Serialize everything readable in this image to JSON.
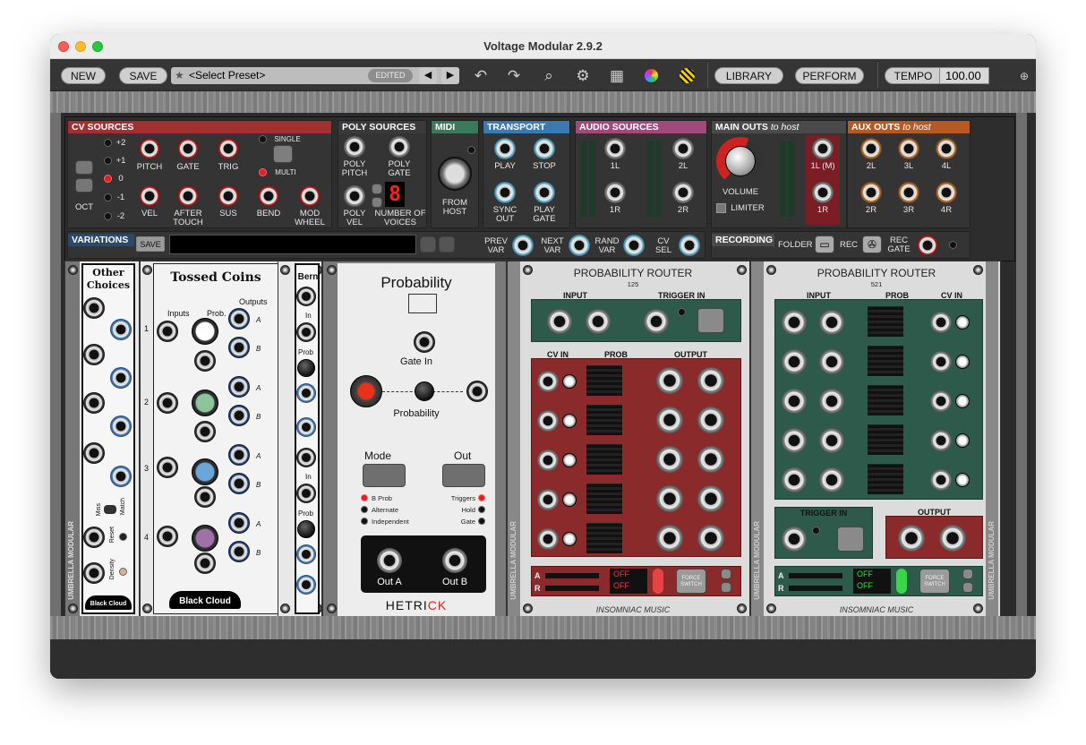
{
  "window": {
    "title": "Voltage Modular 2.9.2"
  },
  "toolbar": {
    "new_label": "NEW",
    "save_label": "SAVE",
    "preset": "<Select Preset>",
    "edited": "EDITED",
    "library_label": "LIBRARY",
    "perform_label": "PERFORM",
    "tempo_label": "TEMPO",
    "tempo_value": "100.00"
  },
  "cv_sources": {
    "title": "CV SOURCES",
    "oct_values": [
      "+2",
      "+1",
      "0",
      "-1",
      "-2"
    ],
    "oct_label": "OCT",
    "row1": [
      "PITCH",
      "GATE",
      "TRIG"
    ],
    "single": "SINGLE",
    "multi": "MULTI",
    "row2": [
      "VEL",
      "AFTER TOUCH",
      "SUS",
      "BEND",
      "MOD WHEEL"
    ]
  },
  "poly_sources": {
    "title": "POLY SOURCES",
    "poly_pitch": "POLY PITCH",
    "poly_gate": "POLY GATE",
    "poly_vel": "POLY VEL",
    "voices": "NUMBER OF VOICES",
    "voices_value": "8"
  },
  "midi": {
    "title": "MIDI",
    "from_host": "FROM HOST"
  },
  "transport": {
    "title": "TRANSPORT",
    "play": "PLAY",
    "stop": "STOP",
    "sync_out": "SYNC OUT",
    "play_gate": "PLAY GATE"
  },
  "audio_sources": {
    "title": "AUDIO SOURCES",
    "l1": "1L",
    "r1": "1R",
    "l2": "2L",
    "r2": "2R"
  },
  "main_outs": {
    "title": "MAIN OUTS",
    "title_suffix": "to host",
    "volume": "VOLUME",
    "limiter": "LIMITER",
    "l": "1L (M)",
    "r": "1R"
  },
  "aux_outs": {
    "title": "AUX OUTS",
    "title_suffix": "to host",
    "labels": [
      "2L",
      "3L",
      "4L",
      "2R",
      "3R",
      "4R"
    ]
  },
  "variations": {
    "title": "VARIATIONS",
    "save": "SAVE",
    "prev": "PREV VAR",
    "next": "NEXT VAR",
    "rand": "RAND VAR",
    "cv_sel": "CV SEL"
  },
  "recording": {
    "title": "RECORDING",
    "folder": "FOLDER",
    "rec": "REC",
    "rec_gate": "REC GATE"
  },
  "other_choices": {
    "title": "Other Choices",
    "miss": "Miss",
    "match": "Match",
    "reset": "Reset",
    "density": "Density",
    "brand": "Black Cloud",
    "vendor": "UMBRELLA MODULAR"
  },
  "tossed_coins": {
    "title": "Tossed Coins",
    "inputs": "Inputs",
    "prob": "Prob.",
    "outputs": "Outputs",
    "nums": [
      "1",
      "2",
      "3",
      "4"
    ],
    "ab": [
      "A",
      "B",
      "A",
      "B",
      "A",
      "B",
      "A",
      "B"
    ],
    "brand": "Black Cloud"
  },
  "bern": {
    "title": "Bern",
    "in1": "In",
    "prob1": "Prob",
    "in2": "In",
    "prob2": "Prob"
  },
  "probability": {
    "title": "Probability",
    "gate_in": "Gate In",
    "prob": "Probability",
    "mode": "Mode",
    "out": "Out",
    "modes": [
      "B Prob",
      "Alternate",
      "Independent"
    ],
    "outs": [
      "Triggers",
      "Hold",
      "Gate"
    ],
    "out_a": "Out A",
    "out_b": "Out B",
    "brand_a": "HETRI",
    "brand_b": "CK"
  },
  "router1": {
    "title": "PROBABILITY ROUTER",
    "num": "125",
    "input": "INPUT",
    "trigger_in": "TRIGGER IN",
    "cv_in": "CV IN",
    "prob": "PROB",
    "output": "OUTPUT",
    "a": "A",
    "r": "R",
    "off1": "OFF",
    "off2": "OFF",
    "force": "FORCE SWITCH",
    "brand": "INSOMNIAC MUSIC"
  },
  "router2": {
    "title": "PROBABILITY ROUTER",
    "num": "521",
    "input": "INPUT",
    "prob": "PROB",
    "cv_in": "CV IN",
    "trigger_in": "TRIGGER IN",
    "output": "OUTPUT",
    "a": "A",
    "r": "R",
    "off1": "OFF",
    "off2": "OFF",
    "force": "FORCE SWITCH",
    "brand": "INSOMNIAC MUSIC"
  }
}
